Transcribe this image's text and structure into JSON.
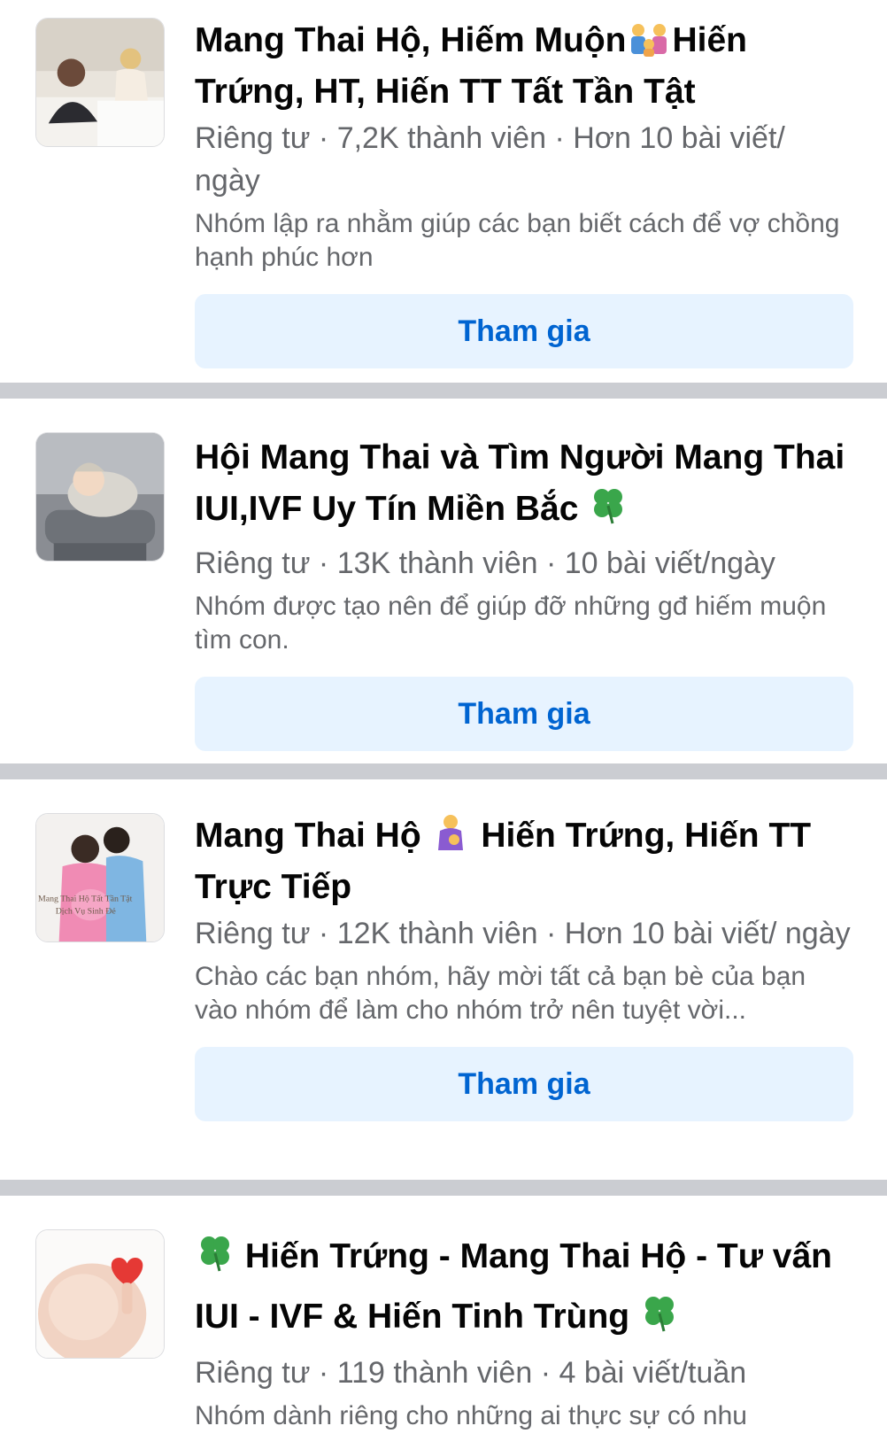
{
  "groups": [
    {
      "title_a": "Mang Thai Hộ, Hiếm Muộn",
      "title_b": "Hiến Trứng, HT, Hiến TT Tất Tần Tật",
      "meta": "Riêng tư · 7,2K thành viên · Hơn 10 bài viết/ ngày",
      "desc": "Nhóm lập ra nhằm giúp các bạn biết cách để vợ chồng hạnh phúc hơn",
      "join_label": "Tham gia",
      "thumb_icon": "couple-bed-photo"
    },
    {
      "title_a": "Hội Mang Thai và Tìm Người Mang Thai IUI,IVF Uy Tín Miền Bắc",
      "title_b": "",
      "meta": "Riêng tư · 13K thành viên · 10 bài viết/ngày",
      "desc": "Nhóm được tạo nên để giúp đỡ những gđ hiếm muộn tìm con.",
      "join_label": "Tham gia",
      "thumb_icon": "sleeping-baby-photo"
    },
    {
      "title_a": "Mang Thai Hộ",
      "title_b": "Hiến Trứng, Hiến TT Trực Tiếp",
      "meta": "Riêng tư · 12K thành viên · Hơn 10 bài viết/ ngày",
      "desc": "Chào các bạn nhóm, hãy mời tất cả bạn bè của bạn vào nhóm để làm cho nhóm trở nên tuyệt vời...",
      "join_label": "Tham gia",
      "thumb_icon": "pregnant-couple-photo",
      "thumb_text": "Mang Thai Hộ Tất Tần Tật Dịch Vụ Sinh Đẻ"
    },
    {
      "title_a": "Hiến Trứng - Mang Thai Hộ - Tư vấn IUI - IVF & Hiến Tinh Trùng",
      "title_b": "",
      "meta": "Riêng tư · 119 thành viên · 4 bài viết/tuần",
      "desc": "Nhóm dành riêng cho những ai thực sự có nhu",
      "join_label": "Tham gia",
      "thumb_icon": "pregnant-belly-heart-photo"
    }
  ],
  "colors": {
    "join_bg": "#e7f3ff",
    "join_text": "#0064d1",
    "separator": "#cbcdd2",
    "meta_text": "#65676b"
  }
}
